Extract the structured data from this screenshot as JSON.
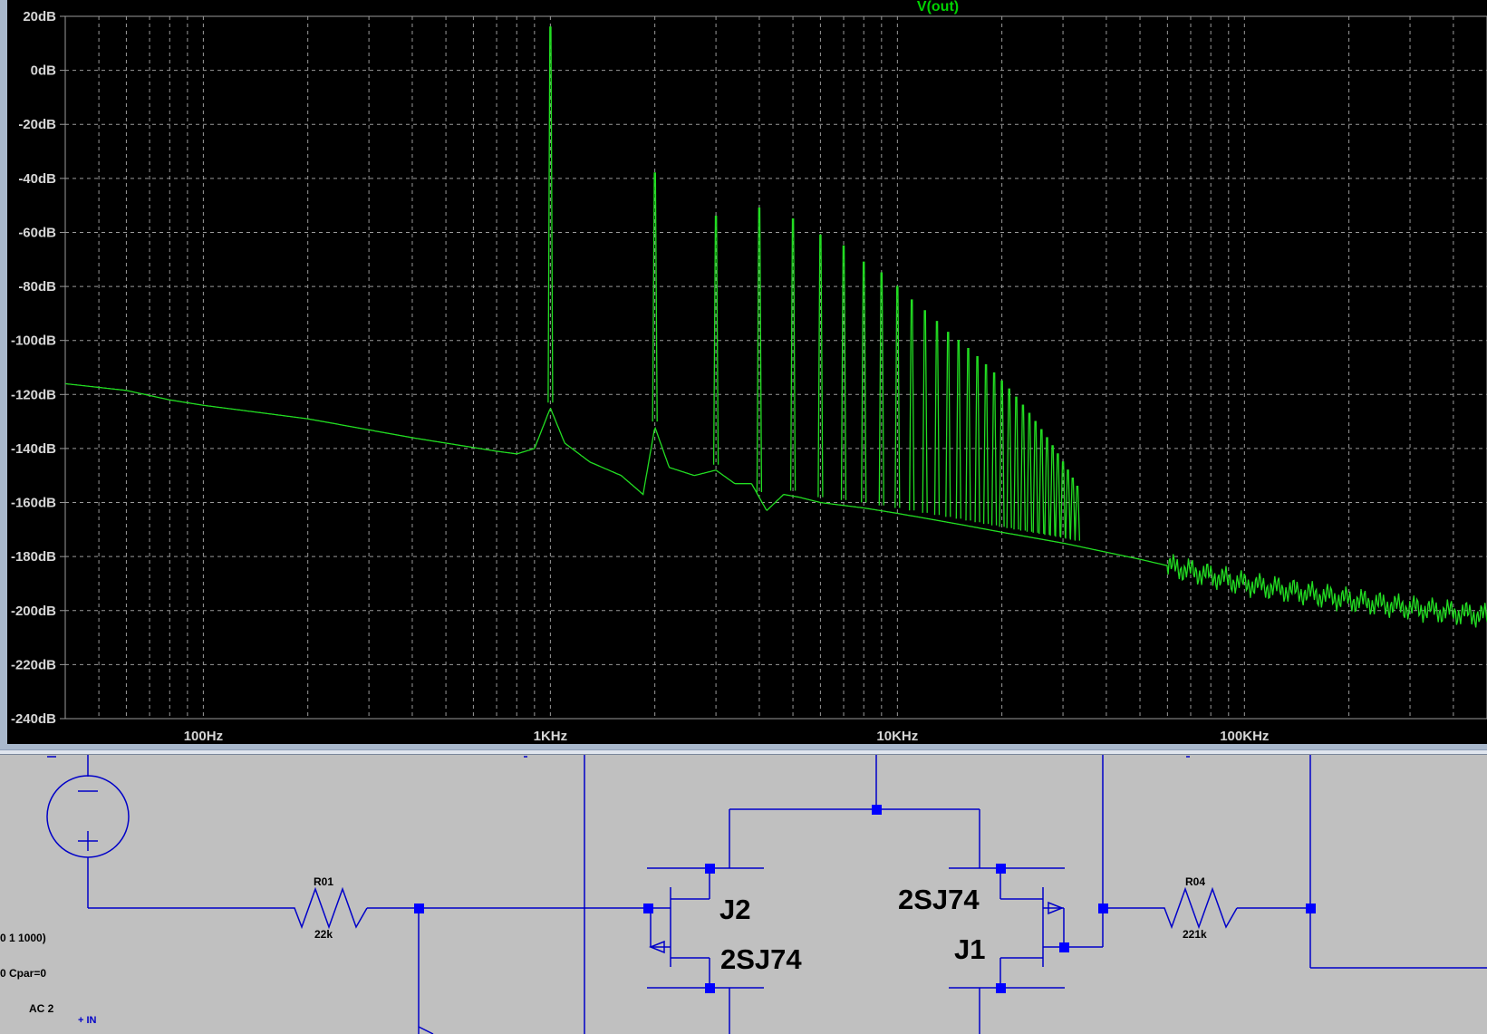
{
  "plot": {
    "trace_title": "V(out)",
    "colors": {
      "background": "#000000",
      "grid": "#9a9a9a",
      "trace": "#22dd22",
      "axis_text": "#d6d6d6"
    }
  },
  "chart_data": {
    "type": "line",
    "title": "V(out)",
    "xlabel": "",
    "ylabel": "",
    "x_scale": "log",
    "xlim": [
      40,
      500000
    ],
    "ylim": [
      -240,
      20
    ],
    "x_ticks": [
      "100Hz",
      "1KHz",
      "10KHz",
      "100KHz"
    ],
    "y_ticks": [
      "20dB",
      "0dB",
      "-20dB",
      "-40dB",
      "-60dB",
      "-80dB",
      "-100dB",
      "-120dB",
      "-140dB",
      "-160dB",
      "-180dB",
      "-200dB",
      "-220dB",
      "-240dB"
    ],
    "grid": true,
    "series": [
      {
        "noise_floor": [
          [
            40,
            -116
          ],
          [
            60,
            -118.5
          ],
          [
            80,
            -122
          ],
          [
            100,
            -124
          ],
          [
            200,
            -129
          ],
          [
            400,
            -136
          ],
          [
            700,
            -141
          ],
          [
            800,
            -142
          ],
          [
            900,
            -140
          ],
          [
            1000,
            -125
          ],
          [
            1100,
            -138
          ],
          [
            1300,
            -145
          ],
          [
            1600,
            -150
          ],
          [
            1850,
            -157
          ],
          [
            2000,
            -132
          ],
          [
            2200,
            -147
          ],
          [
            2600,
            -150
          ],
          [
            3000,
            -148
          ],
          [
            3400,
            -153
          ],
          [
            3800,
            -153
          ],
          [
            4200,
            -163
          ],
          [
            4700,
            -157
          ],
          [
            5200,
            -158
          ],
          [
            6000,
            -160
          ],
          [
            8000,
            -162
          ],
          [
            10000,
            -164
          ],
          [
            15000,
            -168
          ],
          [
            20000,
            -171
          ],
          [
            30000,
            -175
          ],
          [
            50000,
            -181
          ],
          [
            100000,
            -190
          ],
          [
            200000,
            -196
          ],
          [
            300000,
            -199
          ],
          [
            500000,
            -202
          ]
        ],
        "harmonics": [
          {
            "f": 1000,
            "peak": 16
          },
          {
            "f": 2000,
            "peak": -38
          },
          {
            "f": 3000,
            "peak": -54
          },
          {
            "f": 4000,
            "peak": -51
          },
          {
            "f": 5000,
            "peak": -55
          },
          {
            "f": 6000,
            "peak": -61
          },
          {
            "f": 7000,
            "peak": -65
          },
          {
            "f": 8000,
            "peak": -71
          },
          {
            "f": 9000,
            "peak": -75
          },
          {
            "f": 10000,
            "peak": -80
          },
          {
            "f": 11000,
            "peak": -85
          },
          {
            "f": 12000,
            "peak": -89
          },
          {
            "f": 13000,
            "peak": -93
          },
          {
            "f": 14000,
            "peak": -97
          },
          {
            "f": 15000,
            "peak": -100
          },
          {
            "f": 16000,
            "peak": -103
          },
          {
            "f": 17000,
            "peak": -106
          },
          {
            "f": 18000,
            "peak": -109
          },
          {
            "f": 19000,
            "peak": -112
          },
          {
            "f": 20000,
            "peak": -115
          },
          {
            "f": 21000,
            "peak": -118
          },
          {
            "f": 22000,
            "peak": -121
          },
          {
            "f": 23000,
            "peak": -124
          },
          {
            "f": 24000,
            "peak": -127
          },
          {
            "f": 25000,
            "peak": -130
          },
          {
            "f": 26000,
            "peak": -133
          },
          {
            "f": 27000,
            "peak": -136
          },
          {
            "f": 28000,
            "peak": -139
          },
          {
            "f": 29000,
            "peak": -142
          },
          {
            "f": 30000,
            "peak": -145
          },
          {
            "f": 31000,
            "peak": -148
          },
          {
            "f": 32000,
            "peak": -151
          },
          {
            "f": 33000,
            "peak": -154
          }
        ]
      }
    ]
  },
  "schematic": {
    "labels": {
      "r01_name": "R01",
      "r01_value": "22k",
      "r04_name": "R04",
      "r04_value": "221k",
      "j2_name": "J2",
      "j2_part": "2SJ74",
      "j1_name": "J1",
      "j1_part": "2SJ74",
      "source_line1": "0 1 1000)",
      "source_line2": "0 Cpar=0",
      "source_line3": "AC 2",
      "net_in": "+ IN"
    },
    "colors": {
      "wire": "#0000c8",
      "junction": "#0000ff",
      "background": "#c0c0c0"
    }
  }
}
